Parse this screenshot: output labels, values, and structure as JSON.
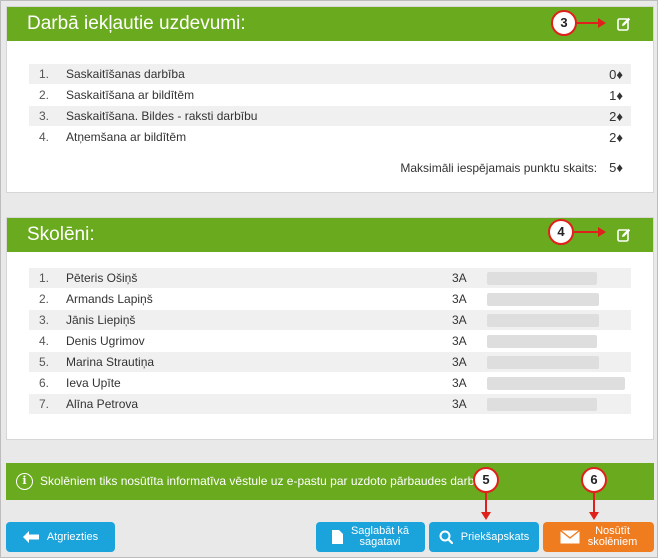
{
  "tasks": {
    "title": "Darbā iekļautie uzdevumi:",
    "callout": "3",
    "items": [
      {
        "num": "1.",
        "name": "Saskaitīšanas darbība",
        "points": "0♦"
      },
      {
        "num": "2.",
        "name": "Saskaitīšana ar bildītēm",
        "points": "1♦"
      },
      {
        "num": "3.",
        "name": "Saskaitīšana. Bildes - raksti darbību",
        "points": "2♦"
      },
      {
        "num": "4.",
        "name": "Atņemšana ar bildītēm",
        "points": "2♦"
      }
    ],
    "max_label": "Maksimāli iespējamais punktu skaits:",
    "max_points": "5♦"
  },
  "students": {
    "title": "Skolēni:",
    "callout": "4",
    "items": [
      {
        "num": "1.",
        "name": "Pēteris Ošiņš",
        "class": "3A"
      },
      {
        "num": "2.",
        "name": "Armands Lapiņš",
        "class": "3A"
      },
      {
        "num": "3.",
        "name": "Jānis Liepiņš",
        "class": "3A"
      },
      {
        "num": "4.",
        "name": "Denis Ugrimov",
        "class": "3A"
      },
      {
        "num": "5.",
        "name": "Marina Strautiņa",
        "class": "3A"
      },
      {
        "num": "6.",
        "name": "Ieva Upīte",
        "class": "3A"
      },
      {
        "num": "7.",
        "name": "Alīna Petrova",
        "class": "3A"
      }
    ]
  },
  "info": {
    "text": "Skolēniem tiks nosūtīta informatīva vēstule uz e-pastu par uzdoto pārbaudes darbu."
  },
  "buttons": {
    "back": "Atgriezties",
    "save_line1": "Saglabāt kā",
    "save_line2": "sagatavi",
    "preview": "Priekšapskats",
    "send_line1": "Nosūtīt",
    "send_line2": "skolēniem",
    "callout_preview": "5",
    "callout_send": "6"
  },
  "colors": {
    "header_green": "#6aaa1e",
    "button_blue": "#1ba3dc",
    "button_orange": "#f07c20",
    "callout_red": "#e0211b"
  }
}
